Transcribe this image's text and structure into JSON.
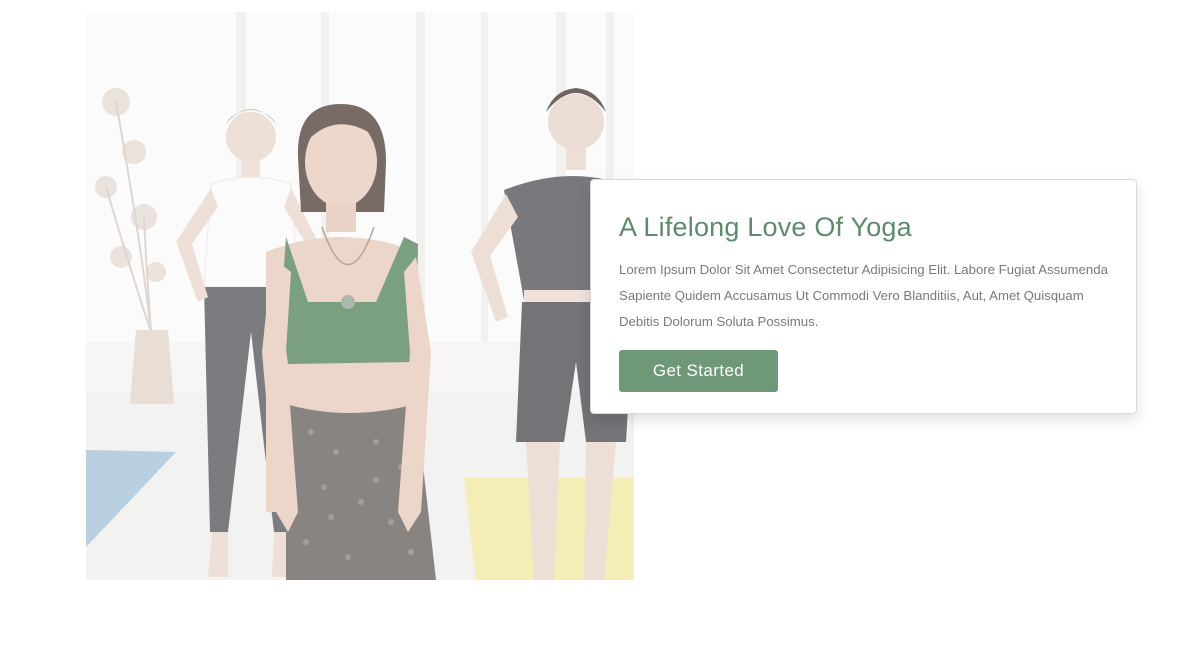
{
  "hero": {
    "image_alt": "Three women standing in a bright yoga studio",
    "card": {
      "title": "A Lifelong Love Of Yoga",
      "body": "Lorem Ipsum Dolor Sit Amet Consectetur Adipisicing Elit. Labore Fugiat Assumenda Sapiente Quidem Accusamus Ut Commodi Vero Blanditiis, Aut, Amet Quisquam Debitis Dolorum Soluta Possimus.",
      "button_label": "Get Started"
    }
  },
  "colors": {
    "accent_text": "#5e8b6d",
    "button_bg": "#6e9878",
    "body_text": "#7a7a7a"
  }
}
